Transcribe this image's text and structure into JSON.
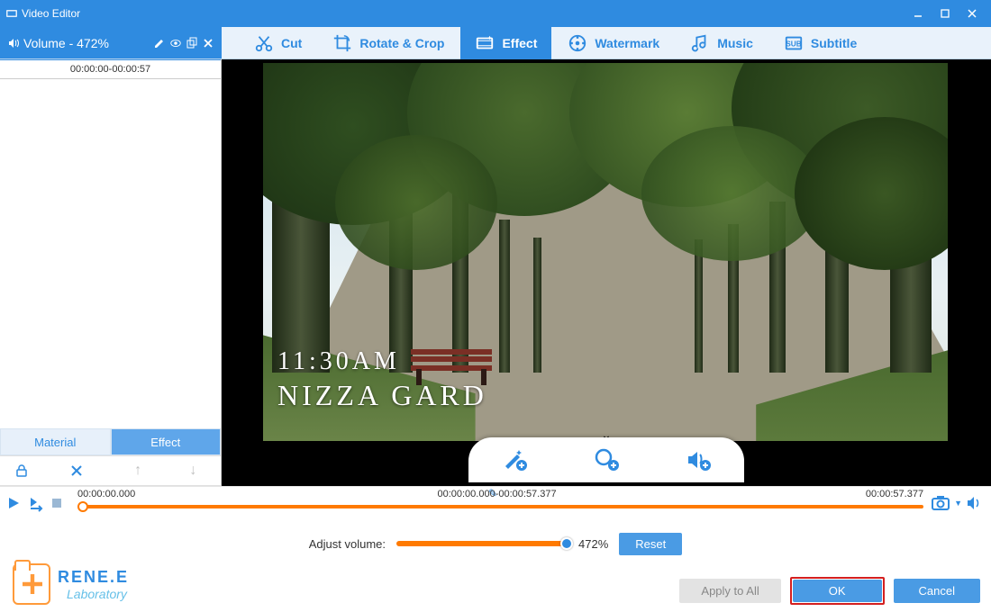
{
  "window": {
    "title": "Video Editor"
  },
  "volume_bar": {
    "label": "Volume - 472%"
  },
  "tabs": {
    "cut": "Cut",
    "rotate": "Rotate & Crop",
    "effect": "Effect",
    "watermark": "Watermark",
    "music": "Music",
    "subtitle": "Subtitle",
    "active": "effect"
  },
  "sidebar": {
    "clip_range": "00:00:00-00:00:57",
    "tab_material": "Material",
    "tab_effect": "Effect"
  },
  "overlay": {
    "time": "11:30AM",
    "place": "NIZZA GARD"
  },
  "timeline": {
    "start": "00:00:00.000",
    "range": "00:00:00.000-00:00:57.377",
    "end": "00:00:57.377"
  },
  "adjust": {
    "label": "Adjust volume:",
    "value": "472%",
    "reset": "Reset"
  },
  "footer": {
    "apply_all": "Apply to All",
    "ok": "OK",
    "cancel": "Cancel",
    "brand1": "RENE.E",
    "brand2": "Laboratory"
  }
}
